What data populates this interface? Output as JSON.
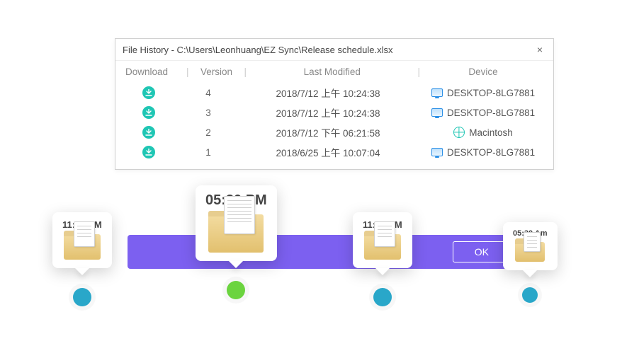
{
  "dialog": {
    "title": "File History - C:\\Users\\Leonhuang\\EZ Sync\\Release schedule.xlsx",
    "close": "×",
    "headers": {
      "download": "Download",
      "version": "Version",
      "last_modified": "Last Modified",
      "device": "Device"
    },
    "rows": [
      {
        "version": "4",
        "modified": "2018/7/12 上午 10:24:38",
        "device": "DESKTOP-8LG7881",
        "device_kind": "pc"
      },
      {
        "version": "3",
        "modified": "2018/7/12 上午 10:24:38",
        "device": "DESKTOP-8LG7881",
        "device_kind": "pc"
      },
      {
        "version": "2",
        "modified": "2018/7/12 下午 06:21:58",
        "device": "Macintosh",
        "device_kind": "web"
      },
      {
        "version": "1",
        "modified": "2018/6/25 上午 10:07:04",
        "device": "DESKTOP-8LG7881",
        "device_kind": "pc"
      }
    ]
  },
  "ribbon": {
    "ok": "OK"
  },
  "timeline": {
    "m1": {
      "time": "11:30 AM",
      "dot": "blue"
    },
    "m2": {
      "time": "05:30 PM",
      "dot": "green"
    },
    "m3": {
      "time": "11:30 PM",
      "dot": "blue"
    },
    "m4": {
      "time": "05:30 Am",
      "dot": "blue"
    }
  },
  "colors": {
    "accent": "#7c60f0",
    "download_icon": "#1fc6b4"
  }
}
